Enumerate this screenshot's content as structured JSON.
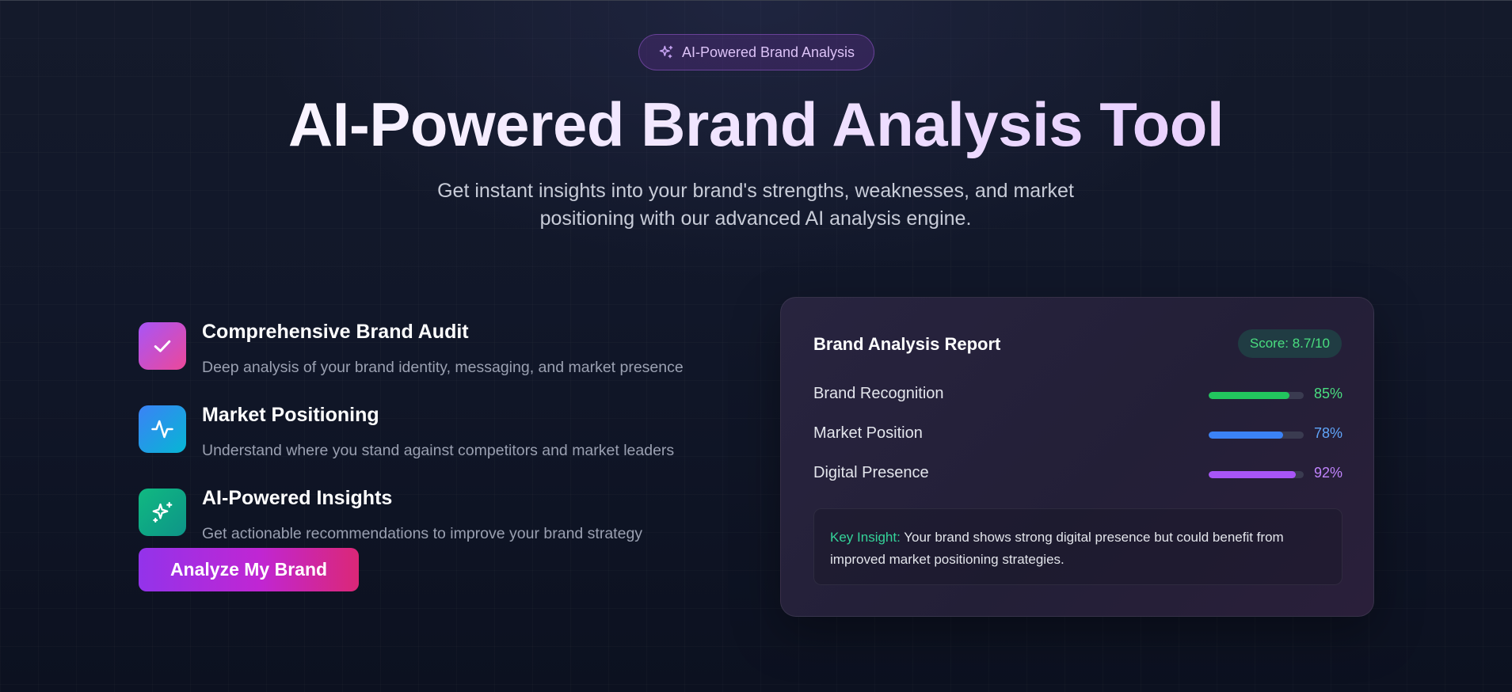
{
  "hero": {
    "badge_label": "AI-Powered Brand Analysis",
    "badge_icon": "sparkles-icon",
    "title": "AI-Powered Brand Analysis Tool",
    "subtitle": "Get instant insights into your brand's strengths, weaknesses, and market positioning with our advanced AI analysis engine."
  },
  "features": [
    {
      "icon": "check-icon",
      "title": "Comprehensive Brand Audit",
      "description": "Deep analysis of your brand identity, messaging, and market presence",
      "colors": [
        "#a855f7",
        "#ec4899"
      ]
    },
    {
      "icon": "activity-icon",
      "title": "Market Positioning",
      "description": "Understand where you stand against competitors and market leaders",
      "colors": [
        "#3b82f6",
        "#06b6d4"
      ]
    },
    {
      "icon": "sparkles-icon",
      "title": "AI-Powered Insights",
      "description": "Get actionable recommendations to improve your brand strategy",
      "colors": [
        "#10b981",
        "#0d9488"
      ]
    }
  ],
  "cta": {
    "label": "Analyze My Brand"
  },
  "report": {
    "title": "Brand Analysis Report",
    "score": "Score: 8.7/10",
    "metrics": [
      {
        "label": "Brand Recognition",
        "percent_label": "85%",
        "value": 85,
        "color": "#22c55e",
        "text_color": "#4ade80"
      },
      {
        "label": "Market Position",
        "percent_label": "78%",
        "value": 78,
        "color": "#3b82f6",
        "text_color": "#60a5fa"
      },
      {
        "label": "Digital Presence",
        "percent_label": "92%",
        "value": 92,
        "color": "#a855f7",
        "text_color": "#c084fc"
      }
    ],
    "insight": {
      "key_label": "Key Insight:",
      "text": " Your brand shows strong digital presence but could benefit from improved market positioning strategies."
    }
  }
}
